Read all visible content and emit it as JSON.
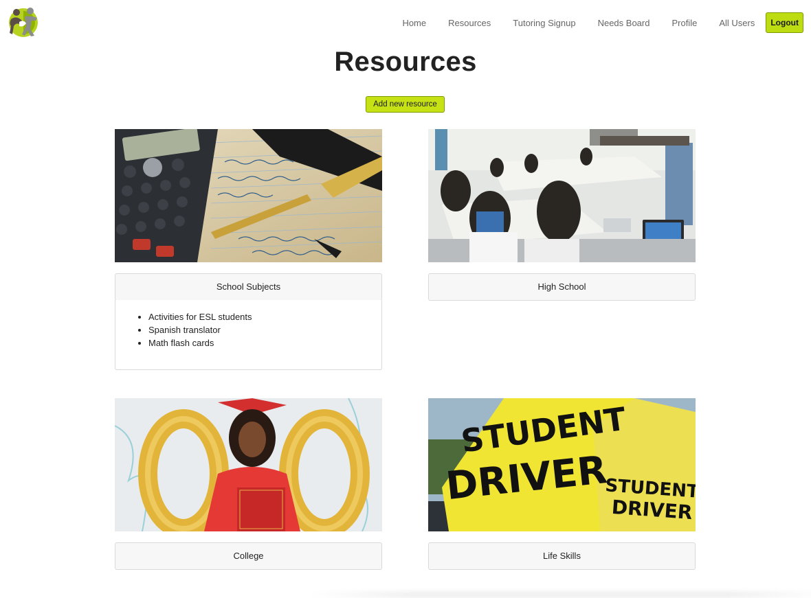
{
  "nav": {
    "logo": "mentor-logo",
    "items": [
      "Home",
      "Resources",
      "Tutoring Signup",
      "Needs Board",
      "Profile",
      "All Users"
    ],
    "logout_label": "Logout"
  },
  "page": {
    "title": "Resources",
    "add_button_label": "Add new resource",
    "accent_color": "#c6e215"
  },
  "cards": [
    {
      "category": "School Subjects",
      "image": "calculator-and-notes-photo",
      "expanded": true,
      "items": [
        "Activities for ESL students",
        "Spanish translator",
        "Math flash cards"
      ]
    },
    {
      "category": "High School",
      "image": "classroom-students-photo",
      "expanded": false,
      "items": []
    },
    {
      "category": "College",
      "image": "graduate-with-balloons-photo",
      "expanded": false,
      "items": []
    },
    {
      "category": "Life Skills",
      "image": "student-driver-sign-photo",
      "expanded": false,
      "items": []
    }
  ]
}
